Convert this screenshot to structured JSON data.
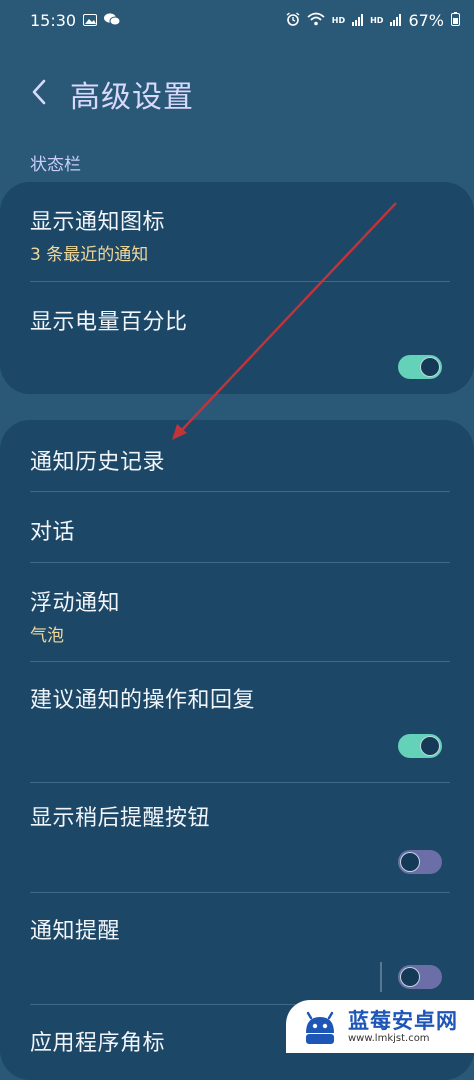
{
  "status_bar": {
    "time": "15:30",
    "network_label_1": "HD",
    "network_label_2": "HD",
    "battery": "67%",
    "icons": [
      "image-icon",
      "wechat-icon",
      "alarm-icon",
      "wifi-icon",
      "signal-icon",
      "battery-icon"
    ]
  },
  "header": {
    "back_icon": "chevron-left-icon",
    "title": "高级设置"
  },
  "section": {
    "label": "状态栏"
  },
  "card1": {
    "items": [
      {
        "label": "显示通知图标",
        "subtitle": "3 条最近的通知"
      },
      {
        "label": "显示电量百分比",
        "toggle": true
      }
    ]
  },
  "card2": {
    "items": [
      {
        "label": "通知历史记录"
      },
      {
        "label": "对话"
      },
      {
        "label": "浮动通知",
        "subtitle": "气泡"
      },
      {
        "label": "建议通知的操作和回复",
        "toggle": true
      },
      {
        "label": "显示稍后提醒按钮",
        "toggle": false
      },
      {
        "label": "通知提醒",
        "toggle": false
      },
      {
        "label": "应用程序角标"
      }
    ]
  },
  "colors": {
    "background": "#2a5877",
    "card": "#1d4766",
    "title": "#d8d9fb",
    "subtitle": "#f0d89a",
    "toggle_on": "#63d2b9",
    "toggle_off": "#6c6fa7",
    "annotation_arrow": "#c0343a"
  },
  "watermark": {
    "name": "蓝莓安卓网",
    "url": "www.lmkjst.com"
  }
}
